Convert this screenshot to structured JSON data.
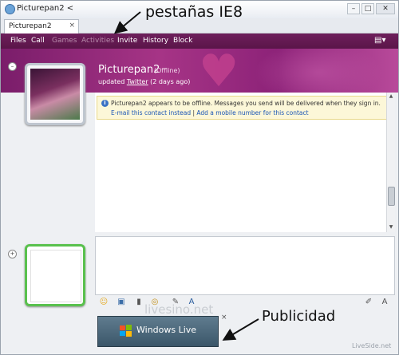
{
  "window": {
    "title": "Picturepan2 <"
  },
  "tab": {
    "label": "Picturepan2",
    "close": "×"
  },
  "menu": {
    "items": [
      "Files",
      "Call",
      "Games",
      "Activities",
      "Invite",
      "History",
      "Block"
    ]
  },
  "contact": {
    "name": "Picturepan2",
    "status": "(Offline)",
    "updated_prefix": "updated",
    "updated_link": "Twitter",
    "updated_time": "(2 days ago)"
  },
  "info": {
    "message": "Picturepan2 appears to be offline. Messages you send will be delivered when they sign in.",
    "link1": "E-mail this contact instead",
    "separator": "|",
    "link2": "Add a mobile number for this contact"
  },
  "ad": {
    "text": "Windows Live",
    "close": "×"
  },
  "annotations": {
    "tabs": "pestañas IE8",
    "ads": "Publicidad"
  },
  "watermarks": {
    "center": "livesino.net",
    "corner": "LiveSide.net"
  },
  "icons": [
    "app-icon",
    "minimize-icon",
    "maximize-icon",
    "close-icon",
    "menu-options-icon",
    "info-icon",
    "emoticon-icon",
    "wink-icon",
    "voice-clip-icon",
    "nudge-icon",
    "font-icon",
    "handwriting-icon",
    "windows-flag-icon"
  ],
  "colors": {
    "menubar": "#5a1549",
    "banner": "#a63486",
    "infobar": "#fcf7d8",
    "link": "#1a55b5",
    "presence_online": "#59c14d"
  }
}
